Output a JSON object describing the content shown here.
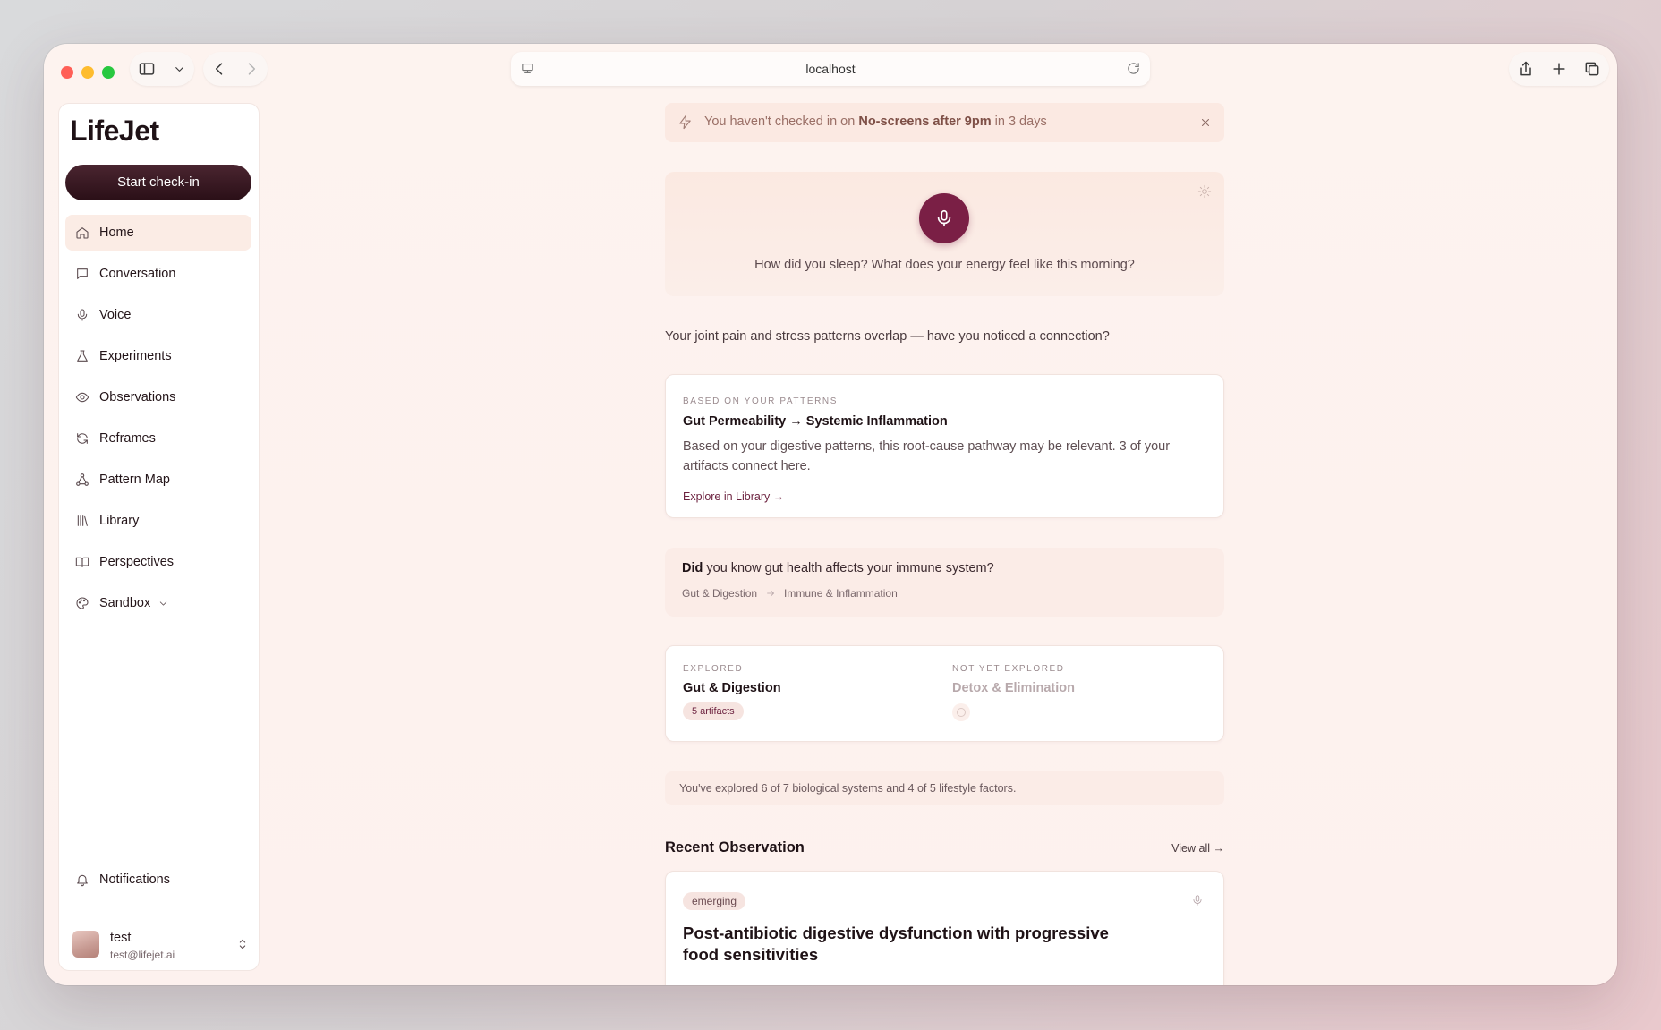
{
  "browser": {
    "url": "localhost"
  },
  "sidebar": {
    "logo": "LifeJet",
    "checkin_button": "Start check-in",
    "items": [
      {
        "label": "Home",
        "icon": "home-icon",
        "active": true
      },
      {
        "label": "Conversation",
        "icon": "chat-icon"
      },
      {
        "label": "Voice",
        "icon": "mic-icon"
      },
      {
        "label": "Experiments",
        "icon": "flask-icon"
      },
      {
        "label": "Observations",
        "icon": "eye-icon"
      },
      {
        "label": "Reframes",
        "icon": "refresh-icon"
      },
      {
        "label": "Pattern Map",
        "icon": "network-icon"
      },
      {
        "label": "Library",
        "icon": "library-icon"
      },
      {
        "label": "Perspectives",
        "icon": "book-open-icon"
      },
      {
        "label": "Sandbox",
        "icon": "palette-icon"
      }
    ],
    "notifications": "Notifications",
    "user": {
      "name": "test",
      "email": "test@lifejet.ai"
    }
  },
  "alert": {
    "prefix": "You haven't checked in on ",
    "habit": "No-screens after 9pm",
    "suffix": " in 3 days"
  },
  "voice": {
    "prompt": "How did you sleep? What does your energy feel like this morning?"
  },
  "insight_question": "Your joint pain and stress patterns overlap — have you noticed a connection?",
  "pattern_card": {
    "eyebrow": "Based on your patterns",
    "title": "Gut Permeability → Systemic Inflammation",
    "description": "Based on your digestive patterns, this root-cause pathway may be relevant. 3 of your artifacts connect here.",
    "link": "Explore in Library →"
  },
  "fact_card": {
    "lead": "Did",
    "question": " you know gut health affects your immune system?",
    "from": "Gut & Digestion",
    "to": "Immune & Inflammation"
  },
  "systems": {
    "explored_label": "Explored",
    "explored_title": "Gut & Digestion",
    "explored_badge": "5 artifacts",
    "unexplored_label": "Not yet explored",
    "unexplored_title": "Detox & Elimination"
  },
  "progress_note": "You've explored 6 of 7 biological systems and 4 of 5 lifestyle factors.",
  "recent": {
    "title": "Recent Observation",
    "view_all": "View all →",
    "badge": "emerging",
    "observation_title": "Post-antibiotic digestive dysfunction with progressive food sensitivities"
  },
  "colors": {
    "accent": "#7a1f45",
    "button_dark": "#2a0f17",
    "background": "#fdf3ef"
  }
}
